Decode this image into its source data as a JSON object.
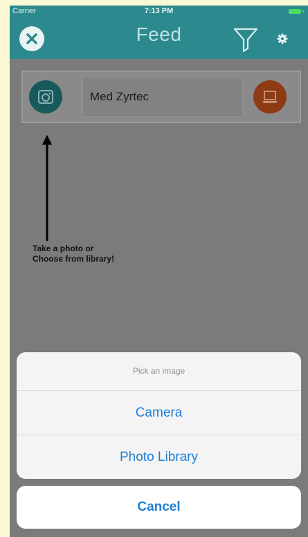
{
  "status_bar": {
    "carrier": "Carrier",
    "time": "7:13 PM"
  },
  "nav": {
    "title": "Feed",
    "close_icon": "close-icon",
    "filter_icon": "filter-icon",
    "settings_icon": "gear-icon"
  },
  "entry": {
    "text": "Med Zyrtec",
    "camera_icon": "camera-icon",
    "save_icon": "laptop-icon"
  },
  "hint": {
    "text": "Take a photo or\nChoose from library!"
  },
  "action_sheet": {
    "title": "Pick an image",
    "options": [
      "Camera",
      "Photo Library"
    ],
    "cancel": "Cancel"
  },
  "colors": {
    "nav": "#2c8a8e",
    "action_blue": "#1d7fd6",
    "save_button": "#8e3a14",
    "camera_button": "#18595c"
  }
}
